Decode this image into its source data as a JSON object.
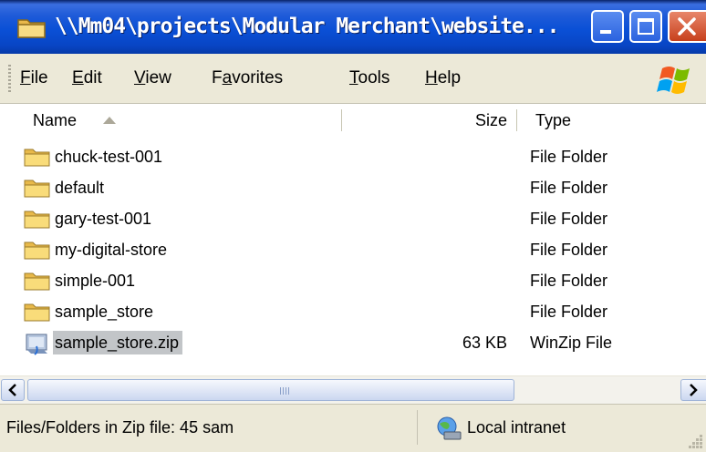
{
  "window": {
    "title": "\\\\Mm04\\projects\\Modular Merchant\\website..."
  },
  "title_buttons": {
    "minimize": "minimize-icon",
    "maximize": "maximize-icon",
    "close": "close-icon"
  },
  "menu": {
    "items": [
      {
        "accel": "F",
        "rest": "ile"
      },
      {
        "accel": "E",
        "rest": "dit"
      },
      {
        "accel": "V",
        "rest": "iew"
      },
      {
        "pre": "F",
        "accel": "a",
        "rest": "vorites"
      },
      {
        "accel": "T",
        "rest": "ools"
      },
      {
        "accel": "H",
        "rest": "elp"
      }
    ]
  },
  "columns": {
    "name": "Name",
    "size": "Size",
    "type": "Type",
    "sort_indicator": "sort-ascending-icon"
  },
  "files": [
    {
      "name": "chuck-test-001",
      "size": "",
      "type": "File Folder",
      "icon": "folder-icon"
    },
    {
      "name": "default",
      "size": "",
      "type": "File Folder",
      "icon": "folder-icon"
    },
    {
      "name": "gary-test-001",
      "size": "",
      "type": "File Folder",
      "icon": "folder-icon"
    },
    {
      "name": "my-digital-store",
      "size": "",
      "type": "File Folder",
      "icon": "folder-icon"
    },
    {
      "name": "simple-001",
      "size": "",
      "type": "File Folder",
      "icon": "folder-icon"
    },
    {
      "name": "sample_store",
      "size": "",
      "type": "File Folder",
      "icon": "folder-icon"
    },
    {
      "name": "sample_store.zip",
      "size": "63 KB",
      "type": "WinZip File",
      "icon": "winzip-file-icon",
      "selected": true
    }
  ],
  "scrollbar": {
    "left": "scroll-left-icon",
    "right": "scroll-right-icon"
  },
  "status": {
    "text": "Files/Folders in Zip file: 45 sam",
    "zone": "Local intranet",
    "zone_icon": "local-intranet-icon"
  },
  "colors": {
    "titlebar": "#0a50d6",
    "close_button": "#c7401c",
    "selection": "#c2c5c8",
    "folder": "#f6d36a"
  }
}
